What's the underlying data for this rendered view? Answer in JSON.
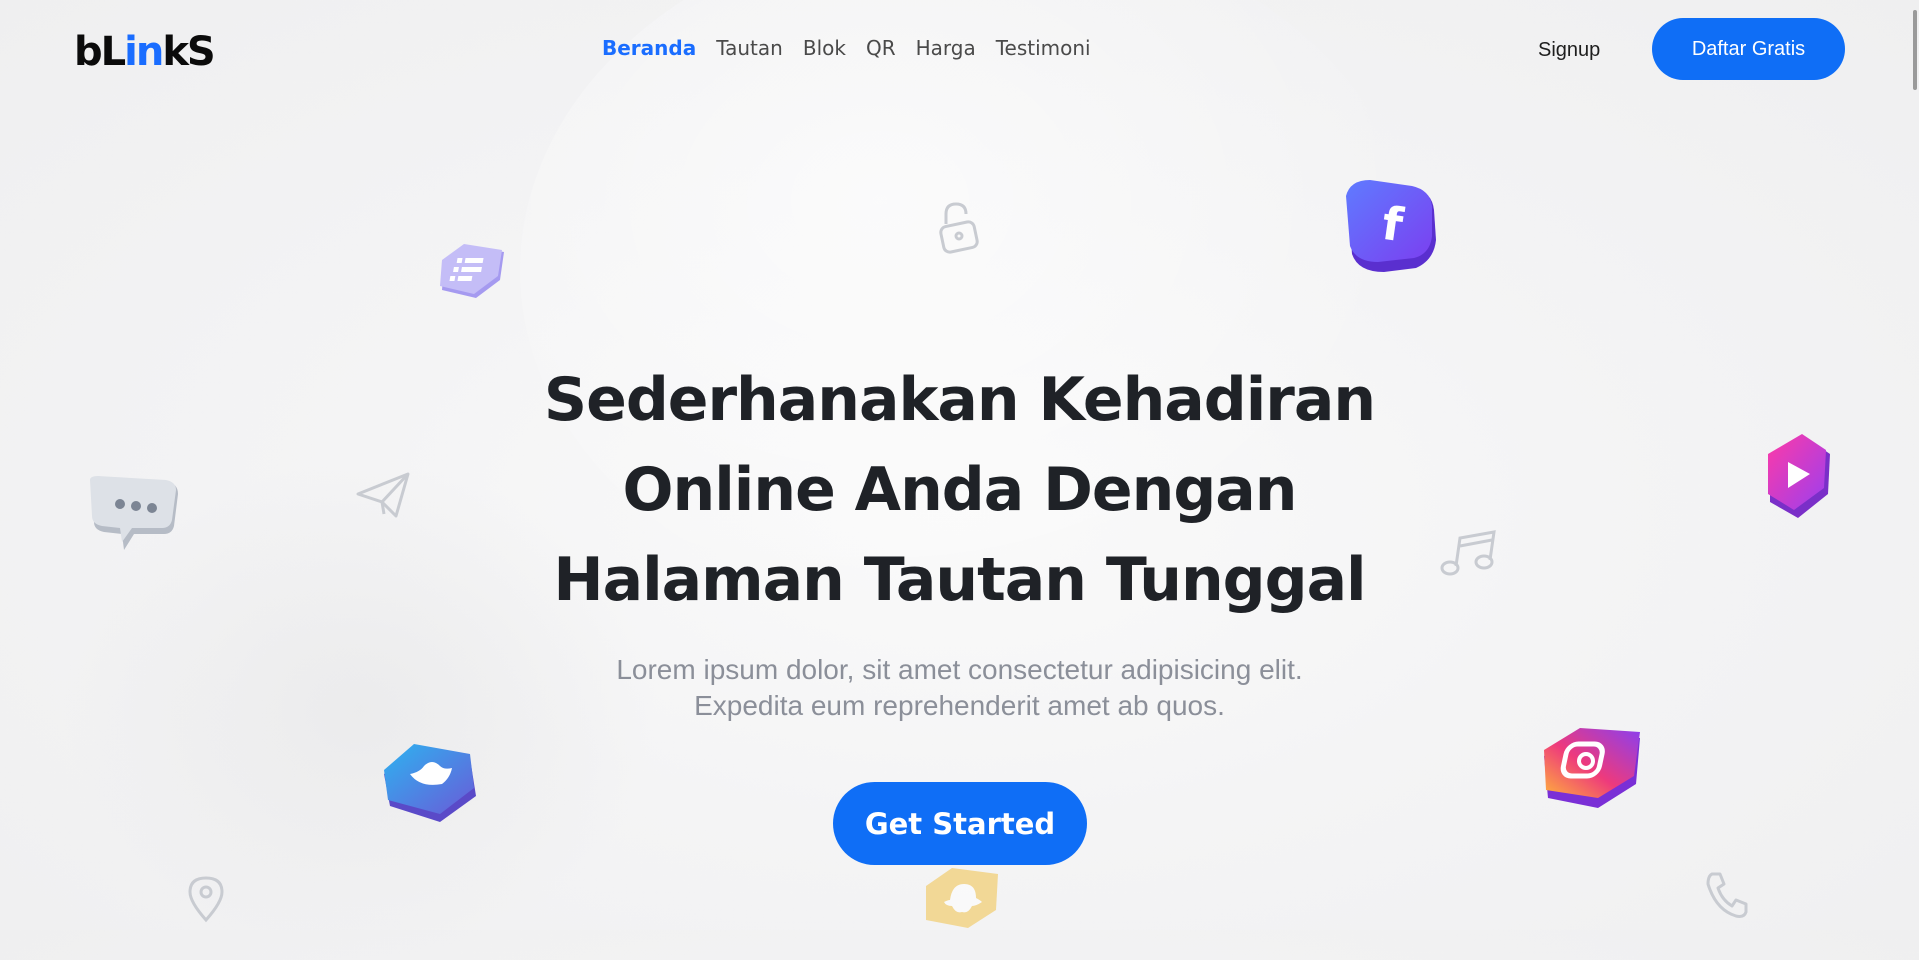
{
  "brand": {
    "logo_pre": "bL",
    "logo_mid": "in",
    "logo_post": "kS",
    "accent_color": "#1a6dff"
  },
  "nav": {
    "items": [
      {
        "label": "Beranda",
        "active": true
      },
      {
        "label": "Tautan",
        "active": false
      },
      {
        "label": "Blok",
        "active": false
      },
      {
        "label": "QR",
        "active": false
      },
      {
        "label": "Harga",
        "active": false
      },
      {
        "label": "Testimoni",
        "active": false
      }
    ]
  },
  "header": {
    "signup_label": "Signup",
    "daftar_label": "Daftar Gratis",
    "button_color": "#0f6ef6"
  },
  "hero": {
    "title_line1": "Sederhanakan Kehadiran",
    "title_line2": "Online Anda Dengan",
    "title_line3": "Halaman Tautan Tunggal",
    "subtitle_line1": "Lorem ipsum dolor, sit amet consectetur adipisicing elit.",
    "subtitle_line2": "Expedita eum reprehenderit amet ab quos.",
    "cta_label": "Get Started"
  },
  "decorations": [
    "facebook-icon",
    "instagram-icon",
    "twitter-icon",
    "youtube-play-icon",
    "chat-bubble-icon",
    "list-icon",
    "lock-icon",
    "paper-plane-icon",
    "music-note-icon",
    "location-pin-icon",
    "phone-icon",
    "snapchat-icon"
  ]
}
